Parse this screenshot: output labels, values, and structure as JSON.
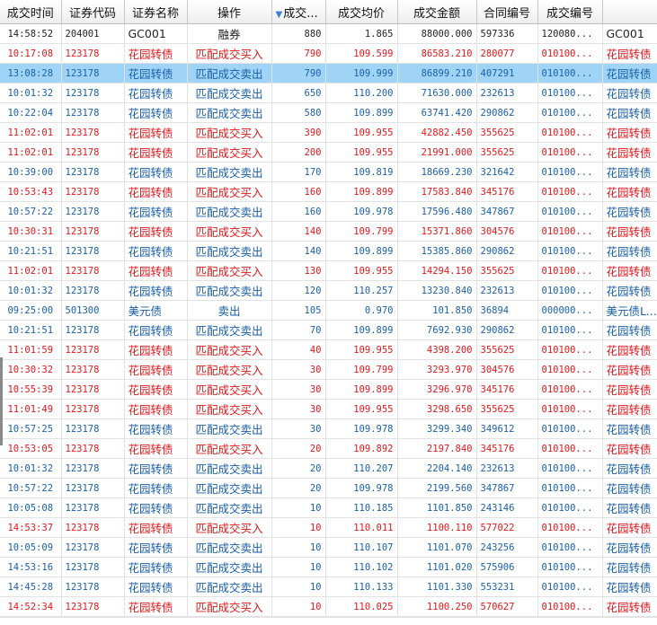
{
  "columns": [
    "成交时间",
    "证券代码",
    "证券名称",
    "操作",
    "成交...",
    "成交均价",
    "成交金额",
    "合同编号",
    "成交编号",
    ""
  ],
  "sorted_column_index": 4,
  "colors": {
    "buy": "#e0181b",
    "sell": "#1a5fa8",
    "neutral": "#222222",
    "selected": "#9fd4f7"
  },
  "rows": [
    {
      "type": "neutral",
      "cells": [
        "14:58:52",
        "204001",
        "GC001",
        "融券",
        "880",
        "1.865",
        "88000.000",
        "597336",
        "120080...",
        "GC001"
      ]
    },
    {
      "type": "buy",
      "cells": [
        "10:17:08",
        "123178",
        "花园转债",
        "匹配成交买入",
        "790",
        "109.599",
        "86583.210",
        "280077",
        "010100...",
        "花园转债"
      ]
    },
    {
      "type": "selected",
      "cells": [
        "13:08:28",
        "123178",
        "花园转债",
        "匹配成交卖出",
        "790",
        "109.999",
        "86899.210",
        "407291",
        "010100...",
        "花园转债"
      ]
    },
    {
      "type": "sell",
      "cells": [
        "10:01:32",
        "123178",
        "花园转债",
        "匹配成交卖出",
        "650",
        "110.200",
        "71630.000",
        "232613",
        "010100...",
        "花园转债"
      ]
    },
    {
      "type": "sell",
      "cells": [
        "10:22:04",
        "123178",
        "花园转债",
        "匹配成交卖出",
        "580",
        "109.899",
        "63741.420",
        "290862",
        "010100...",
        "花园转债"
      ]
    },
    {
      "type": "buy",
      "cells": [
        "11:02:01",
        "123178",
        "花园转债",
        "匹配成交买入",
        "390",
        "109.955",
        "42882.450",
        "355625",
        "010100...",
        "花园转债"
      ]
    },
    {
      "type": "buy",
      "cells": [
        "11:02:01",
        "123178",
        "花园转债",
        "匹配成交买入",
        "200",
        "109.955",
        "21991.000",
        "355625",
        "010100...",
        "花园转债"
      ]
    },
    {
      "type": "sell",
      "cells": [
        "10:39:00",
        "123178",
        "花园转债",
        "匹配成交卖出",
        "170",
        "109.819",
        "18669.230",
        "321642",
        "010100...",
        "花园转债"
      ]
    },
    {
      "type": "buy",
      "cells": [
        "10:53:43",
        "123178",
        "花园转债",
        "匹配成交买入",
        "160",
        "109.899",
        "17583.840",
        "345176",
        "010100...",
        "花园转债"
      ]
    },
    {
      "type": "sell",
      "cells": [
        "10:57:22",
        "123178",
        "花园转债",
        "匹配成交卖出",
        "160",
        "109.978",
        "17596.480",
        "347867",
        "010100...",
        "花园转债"
      ]
    },
    {
      "type": "buy",
      "cells": [
        "10:30:31",
        "123178",
        "花园转债",
        "匹配成交买入",
        "140",
        "109.799",
        "15371.860",
        "304576",
        "010100...",
        "花园转债"
      ]
    },
    {
      "type": "sell",
      "cells": [
        "10:21:51",
        "123178",
        "花园转债",
        "匹配成交卖出",
        "140",
        "109.899",
        "15385.860",
        "290862",
        "010100...",
        "花园转债"
      ]
    },
    {
      "type": "buy",
      "cells": [
        "11:02:01",
        "123178",
        "花园转债",
        "匹配成交买入",
        "130",
        "109.955",
        "14294.150",
        "355625",
        "010100...",
        "花园转债"
      ]
    },
    {
      "type": "sell",
      "cells": [
        "10:01:32",
        "123178",
        "花园转债",
        "匹配成交卖出",
        "120",
        "110.257",
        "13230.840",
        "232613",
        "010100...",
        "花园转债"
      ]
    },
    {
      "type": "sell",
      "cells": [
        "09:25:00",
        "501300",
        "美元债",
        "卖出",
        "105",
        "0.970",
        "101.850",
        "36894",
        "000000...",
        "美元债LOF"
      ]
    },
    {
      "type": "sell",
      "cells": [
        "10:21:51",
        "123178",
        "花园转债",
        "匹配成交卖出",
        "70",
        "109.899",
        "7692.930",
        "290862",
        "010100...",
        "花园转债"
      ]
    },
    {
      "type": "buy",
      "cells": [
        "11:01:59",
        "123178",
        "花园转债",
        "匹配成交买入",
        "40",
        "109.955",
        "4398.200",
        "355625",
        "010100...",
        "花园转债"
      ]
    },
    {
      "type": "buy",
      "cells": [
        "10:30:32",
        "123178",
        "花园转债",
        "匹配成交买入",
        "30",
        "109.799",
        "3293.970",
        "304576",
        "010100...",
        "花园转债"
      ]
    },
    {
      "type": "buy",
      "cells": [
        "10:55:39",
        "123178",
        "花园转债",
        "匹配成交买入",
        "30",
        "109.899",
        "3296.970",
        "345176",
        "010100...",
        "花园转债"
      ]
    },
    {
      "type": "buy",
      "cells": [
        "11:01:49",
        "123178",
        "花园转债",
        "匹配成交买入",
        "30",
        "109.955",
        "3298.650",
        "355625",
        "010100...",
        "花园转债"
      ]
    },
    {
      "type": "sell",
      "cells": [
        "10:57:25",
        "123178",
        "花园转债",
        "匹配成交卖出",
        "30",
        "109.978",
        "3299.340",
        "349612",
        "010100...",
        "花园转债"
      ]
    },
    {
      "type": "buy",
      "cells": [
        "10:53:05",
        "123178",
        "花园转债",
        "匹配成交买入",
        "20",
        "109.892",
        "2197.840",
        "345176",
        "010100...",
        "花园转债"
      ]
    },
    {
      "type": "sell",
      "cells": [
        "10:01:32",
        "123178",
        "花园转债",
        "匹配成交卖出",
        "20",
        "110.207",
        "2204.140",
        "232613",
        "010100...",
        "花园转债"
      ]
    },
    {
      "type": "sell",
      "cells": [
        "10:57:22",
        "123178",
        "花园转债",
        "匹配成交卖出",
        "20",
        "109.978",
        "2199.560",
        "347867",
        "010100...",
        "花园转债"
      ]
    },
    {
      "type": "sell",
      "cells": [
        "10:05:08",
        "123178",
        "花园转债",
        "匹配成交卖出",
        "10",
        "110.185",
        "1101.850",
        "243146",
        "010100...",
        "花园转债"
      ]
    },
    {
      "type": "buy",
      "cells": [
        "14:53:37",
        "123178",
        "花园转债",
        "匹配成交买入",
        "10",
        "110.011",
        "1100.110",
        "577022",
        "010100...",
        "花园转债"
      ]
    },
    {
      "type": "sell",
      "cells": [
        "10:05:09",
        "123178",
        "花园转债",
        "匹配成交卖出",
        "10",
        "110.107",
        "1101.070",
        "243256",
        "010100...",
        "花园转债"
      ]
    },
    {
      "type": "sell",
      "cells": [
        "14:53:16",
        "123178",
        "花园转债",
        "匹配成交卖出",
        "10",
        "110.102",
        "1101.020",
        "575906",
        "010100...",
        "花园转债"
      ]
    },
    {
      "type": "sell",
      "cells": [
        "14:45:28",
        "123178",
        "花园转债",
        "匹配成交卖出",
        "10",
        "110.133",
        "1101.330",
        "553231",
        "010100...",
        "花园转债"
      ]
    },
    {
      "type": "buy",
      "cells": [
        "14:52:34",
        "123178",
        "花园转债",
        "匹配成交买入",
        "10",
        "110.025",
        "1100.250",
        "570627",
        "010100...",
        "花园转债"
      ]
    }
  ]
}
